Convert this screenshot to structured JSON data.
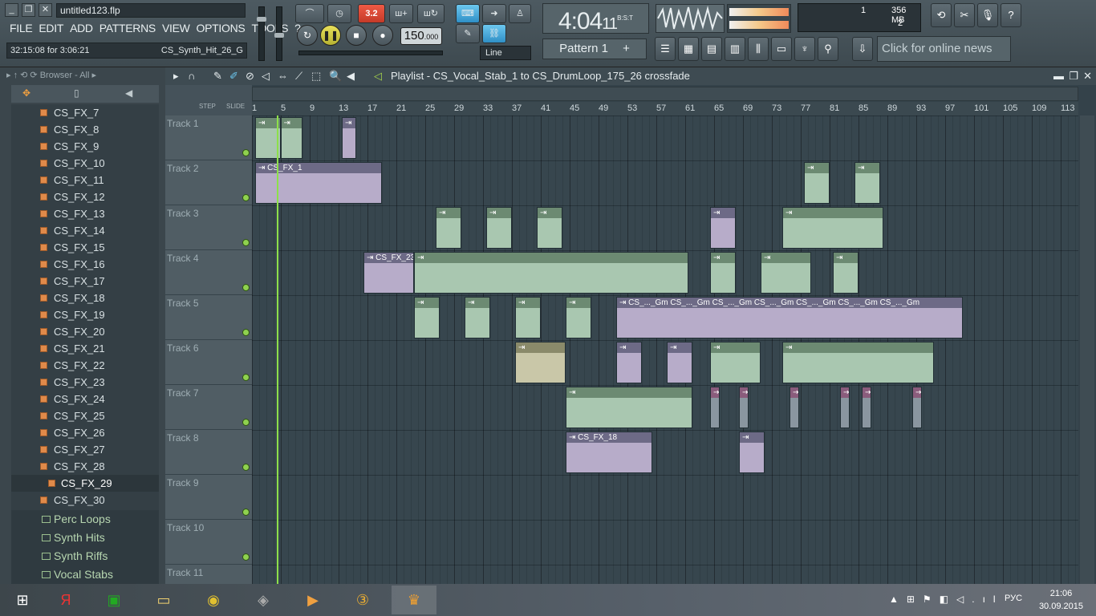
{
  "window": {
    "title": "untitled123.flp"
  },
  "menu": [
    "FILE",
    "EDIT",
    "ADD",
    "PATTERNS",
    "VIEW",
    "OPTIONS",
    "TOOLS",
    "?"
  ],
  "hint": {
    "time": "32:15:08 for 3:06:21",
    "file": "CS_Synth_Hit_26_G"
  },
  "transport": {
    "pattern_song": "3.2",
    "tempo": "150",
    "tempo_frac": ".000",
    "snap": "Line"
  },
  "time": {
    "main": "4:04",
    "frac": "11",
    "unit": "B:S:T"
  },
  "pattern": {
    "label": "Pattern 1",
    "add": "+"
  },
  "cpu": {
    "value": "1",
    "memory": "356 MB",
    "poly": "2"
  },
  "news": {
    "label": "Click for online news"
  },
  "browser": {
    "header": "Browser - All",
    "items": [
      "CS_FX_7",
      "CS_FX_8",
      "CS_FX_9",
      "CS_FX_10",
      "CS_FX_11",
      "CS_FX_12",
      "CS_FX_13",
      "CS_FX_14",
      "CS_FX_15",
      "CS_FX_16",
      "CS_FX_17",
      "CS_FX_18",
      "CS_FX_19",
      "CS_FX_20",
      "CS_FX_21",
      "CS_FX_22",
      "CS_FX_23",
      "CS_FX_24",
      "CS_FX_25",
      "CS_FX_26",
      "CS_FX_27",
      "CS_FX_28",
      "CS_FX_29",
      "CS_FX_30"
    ],
    "selected": "CS_FX_29",
    "folders": [
      "Perc Loops",
      "Synth Hits",
      "Synth Riffs",
      "Vocal Stabs"
    ]
  },
  "playlist": {
    "title": "Playlist - CS_Vocal_Stab_1 to CS_DrumLoop_175_26 crossfade",
    "step": "STEP",
    "slide": "SLIDE",
    "ruler": [
      "1",
      "5",
      "9",
      "13",
      "17",
      "21",
      "25",
      "29",
      "33",
      "37",
      "41",
      "45",
      "49",
      "53",
      "57",
      "61",
      "65",
      "69",
      "73",
      "77",
      "81",
      "85",
      "89",
      "93",
      "97",
      "101",
      "105",
      "109",
      "113"
    ],
    "tracks": [
      "Track 1",
      "Track 2",
      "Track 3",
      "Track 4",
      "Track 5",
      "Track 6",
      "Track 7",
      "Track 8",
      "Track 9",
      "Track 10",
      "Track 11"
    ],
    "clips": [
      {
        "track": 0,
        "start": 1,
        "len": 3.5,
        "c": "g",
        "label": ""
      },
      {
        "track": 0,
        "start": 4.5,
        "len": 3,
        "c": "g",
        "label": ""
      },
      {
        "track": 0,
        "start": 13,
        "len": 2,
        "c": "p",
        "label": ""
      },
      {
        "track": 1,
        "start": 1,
        "len": 17.5,
        "c": "p",
        "label": "CS_FX_1"
      },
      {
        "track": 1,
        "start": 77,
        "len": 3.5,
        "c": "g",
        "label": ""
      },
      {
        "track": 1,
        "start": 84,
        "len": 3.5,
        "c": "g",
        "label": ""
      },
      {
        "track": 2,
        "start": 26,
        "len": 3.5,
        "c": "g",
        "label": ""
      },
      {
        "track": 2,
        "start": 33,
        "len": 3.5,
        "c": "g",
        "label": ""
      },
      {
        "track": 2,
        "start": 40,
        "len": 3.5,
        "c": "g",
        "label": ""
      },
      {
        "track": 2,
        "start": 64,
        "len": 3.5,
        "c": "p",
        "label": ""
      },
      {
        "track": 2,
        "start": 74,
        "len": 14,
        "c": "g",
        "label": ""
      },
      {
        "track": 3,
        "start": 16,
        "len": 7,
        "c": "p",
        "label": "CS_FX_23"
      },
      {
        "track": 3,
        "start": 23,
        "len": 38,
        "c": "g",
        "label": ""
      },
      {
        "track": 3,
        "start": 64,
        "len": 3.5,
        "c": "g",
        "label": ""
      },
      {
        "track": 3,
        "start": 71,
        "len": 7,
        "c": "g",
        "label": ""
      },
      {
        "track": 3,
        "start": 81,
        "len": 3.5,
        "c": "g",
        "label": ""
      },
      {
        "track": 4,
        "start": 23,
        "len": 3.5,
        "c": "g",
        "label": ""
      },
      {
        "track": 4,
        "start": 30,
        "len": 3.5,
        "c": "g",
        "label": ""
      },
      {
        "track": 4,
        "start": 37,
        "len": 3.5,
        "c": "g",
        "label": ""
      },
      {
        "track": 4,
        "start": 44,
        "len": 3.5,
        "c": "g",
        "label": ""
      },
      {
        "track": 4,
        "start": 51,
        "len": 48,
        "c": "p",
        "label": "CS_..._Gm  CS_..._Gm  CS_..._Gm  CS_..._Gm  CS_..._Gm  CS_..._Gm  CS_..._Gm"
      },
      {
        "track": 5,
        "start": 37,
        "len": 7,
        "c": "o",
        "label": ""
      },
      {
        "track": 5,
        "start": 51,
        "len": 3.5,
        "c": "p",
        "label": ""
      },
      {
        "track": 5,
        "start": 58,
        "len": 3.5,
        "c": "p",
        "label": ""
      },
      {
        "track": 5,
        "start": 64,
        "len": 7,
        "c": "g",
        "label": ""
      },
      {
        "track": 5,
        "start": 74,
        "len": 21,
        "c": "g",
        "label": ""
      },
      {
        "track": 6,
        "start": 44,
        "len": 17.5,
        "c": "g",
        "label": ""
      },
      {
        "track": 6,
        "start": 64,
        "len": 1.3,
        "c": "m",
        "label": ""
      },
      {
        "track": 6,
        "start": 68,
        "len": 1.3,
        "c": "m",
        "label": ""
      },
      {
        "track": 6,
        "start": 75,
        "len": 1.3,
        "c": "m",
        "label": ""
      },
      {
        "track": 6,
        "start": 82,
        "len": 1.3,
        "c": "m",
        "label": ""
      },
      {
        "track": 6,
        "start": 85,
        "len": 1.3,
        "c": "m",
        "label": ""
      },
      {
        "track": 6,
        "start": 92,
        "len": 1.3,
        "c": "m",
        "label": ""
      },
      {
        "track": 7,
        "start": 44,
        "len": 12,
        "c": "p",
        "label": "CS_FX_18"
      },
      {
        "track": 7,
        "start": 68,
        "len": 3.5,
        "c": "p",
        "label": ""
      }
    ]
  },
  "taskbar": {
    "lang": "РУС",
    "time": "21:06",
    "date": "30.09.2015"
  }
}
